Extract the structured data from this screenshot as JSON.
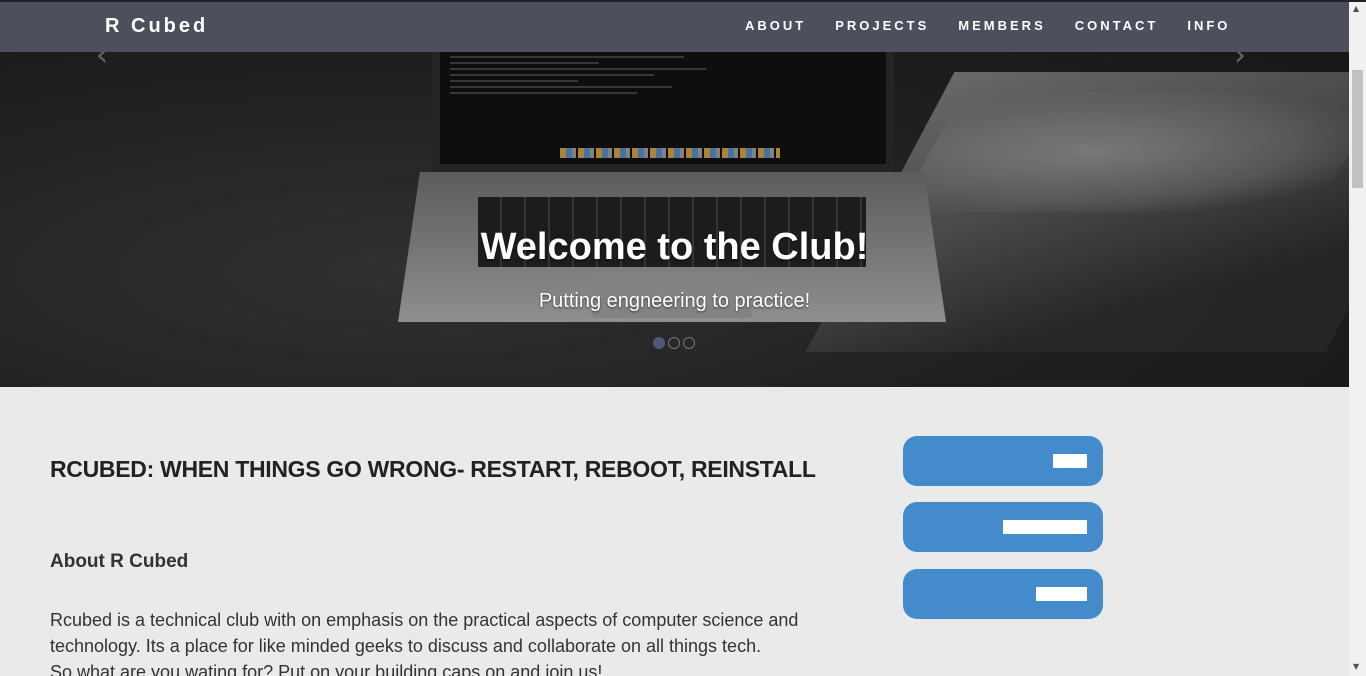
{
  "navbar": {
    "brand": "R Cubed",
    "links": [
      "ABOUT",
      "PROJECTS",
      "MEMBERS",
      "CONTACT",
      "INFO"
    ]
  },
  "carousel": {
    "title": "Welcome to the Club!",
    "subtitle": "Putting engneering to practice!",
    "slide_count": 3,
    "active_slide": 1,
    "prev_icon": "chevron-left-icon",
    "next_icon": "chevron-right-icon"
  },
  "main": {
    "headline": "RCUBED: WHEN THINGS GO WRONG- RESTART, REBOOT, REINSTALL",
    "about_title": "About R Cubed",
    "about_lines": [
      "Rcubed is a technical club with on emphasis on the practical aspects of computer science and",
      "technology. Its a place for like minded geeks to discuss and collaborate on all things tech.",
      "So what are you wating for? Put on your building caps on and join us!"
    ]
  },
  "graphic": {
    "icon": "server-stack-icon",
    "color": "#438bcb"
  },
  "colors": {
    "navbar": "#4b505c",
    "accent": "#438bcb",
    "background": "#eaeaea"
  }
}
